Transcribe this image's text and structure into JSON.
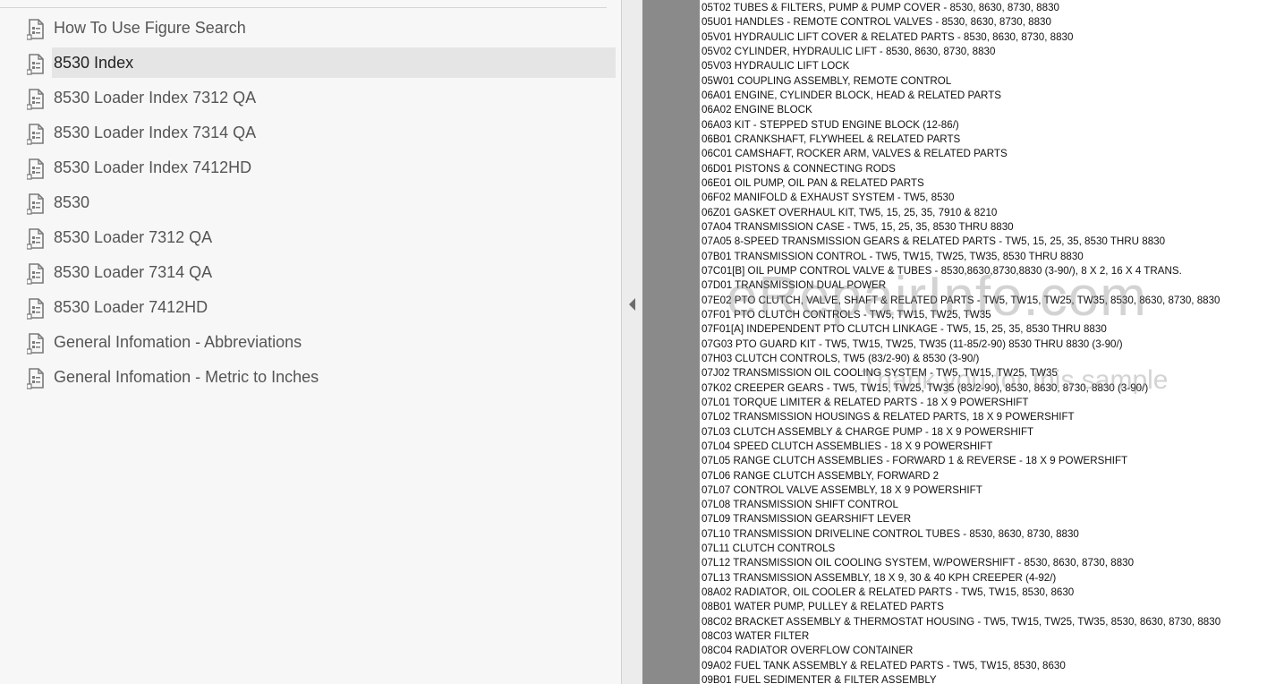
{
  "bookmarks": [
    {
      "label": "How To Use Figure Search",
      "selected": false
    },
    {
      "label": "8530 Index",
      "selected": true
    },
    {
      "label": "8530 Loader Index 7312 QA",
      "selected": false
    },
    {
      "label": "8530 Loader Index 7314 QA",
      "selected": false
    },
    {
      "label": "8530 Loader Index 7412HD",
      "selected": false
    },
    {
      "label": "8530",
      "selected": false
    },
    {
      "label": "8530 Loader 7312 QA",
      "selected": false
    },
    {
      "label": "8530 Loader 7314 QA",
      "selected": false
    },
    {
      "label": "8530 Loader 7412HD",
      "selected": false
    },
    {
      "label": "General Infomation - Abbreviations",
      "selected": false
    },
    {
      "label": "General Infomation - Metric to Inches",
      "selected": false
    }
  ],
  "icons": {
    "bookmark": "page-bookmark-icon",
    "collapse": "chevron-left-icon"
  },
  "watermark": {
    "main": "eRepairInfo.com",
    "sub": "Thank you for this sample"
  },
  "index_lines": [
    "05T02 TUBES & FILTERS, PUMP & PUMP COVER - 8530, 8630, 8730, 8830",
    "05U01 HANDLES - REMOTE CONTROL VALVES - 8530, 8630, 8730, 8830",
    "05V01 HYDRAULIC LIFT COVER & RELATED PARTS - 8530, 8630, 8730, 8830",
    "05V02 CYLINDER, HYDRAULIC LIFT - 8530, 8630, 8730, 8830",
    "05V03 HYDRAULIC LIFT LOCK",
    "05W01 COUPLING ASSEMBLY, REMOTE CONTROL",
    "06A01 ENGINE, CYLINDER BLOCK, HEAD & RELATED PARTS",
    "06A02 ENGINE BLOCK",
    "06A03 KIT - STEPPED STUD ENGINE BLOCK (12-86/)",
    "06B01 CRANKSHAFT, FLYWHEEL & RELATED PARTS",
    "06C01 CAMSHAFT, ROCKER ARM, VALVES & RELATED PARTS",
    "06D01 PISTONS & CONNECTING RODS",
    "06E01 OIL PUMP, OIL PAN & RELATED PARTS",
    "06F02 MANIFOLD & EXHAUST SYSTEM - TW5, 8530",
    "06Z01 GASKET OVERHAUL KIT, TW5, 15, 25, 35, 7910 & 8210",
    "07A04 TRANSMISSION CASE - TW5, 15, 25, 35, 8530 THRU 8830",
    "07A05 8-SPEED TRANSMISSION GEARS & RELATED PARTS - TW5, 15, 25, 35, 8530 THRU 8830",
    "07B01 TRANSMISSION CONTROL - TW5, TW15, TW25, TW35, 8530 THRU 8830",
    "07C01[B] OIL PUMP CONTROL VALVE & TUBES - 8530,8630,8730,8830 (3-90/), 8 X 2, 16 X 4 TRANS.",
    "07D01 TRANSMISSION DUAL POWER",
    "07E02 PTO CLUTCH, VALVE, SHAFT & RELATED PARTS - TW5, TW15, TW25, TW35, 8530, 8630, 8730, 8830",
    "07F01 PTO CLUTCH CONTROLS - TW5, TW15, TW25, TW35",
    "07F01[A] INDEPENDENT PTO CLUTCH LINKAGE - TW5, 15, 25, 35, 8530 THRU 8830",
    "07G03 PTO GUARD KIT - TW5, TW15, TW25, TW35 (11-85/2-90) 8530 THRU 8830 (3-90/)",
    "07H03 CLUTCH CONTROLS, TW5 (83/2-90) & 8530 (3-90/)",
    "07J02 TRANSMISSION OIL COOLING SYSTEM - TW5, TW15, TW25, TW35",
    "07K02 CREEPER GEARS - TW5, TW15, TW25, TW35 (83/2-90), 8530, 8630, 8730, 8830 (3-90/)",
    "07L01 TORQUE LIMITER & RELATED PARTS - 18 X 9 POWERSHIFT",
    "07L02 TRANSMISSION HOUSINGS & RELATED PARTS, 18 X 9 POWERSHIFT",
    "07L03 CLUTCH ASSEMBLY & CHARGE PUMP - 18 X 9 POWERSHIFT",
    "07L04 SPEED CLUTCH ASSEMBLIES - 18 X 9 POWERSHIFT",
    "07L05 RANGE CLUTCH ASSEMBLIES - FORWARD 1 & REVERSE - 18 X 9 POWERSHIFT",
    "07L06 RANGE CLUTCH ASSEMBLY, FORWARD 2",
    "07L07 CONTROL VALVE ASSEMBLY, 18 X 9 POWERSHIFT",
    "07L08 TRANSMISSION SHIFT CONTROL",
    "07L09 TRANSMISSION GEARSHIFT LEVER",
    "07L10 TRANSMISSION DRIVELINE CONTROL TUBES - 8530, 8630, 8730, 8830",
    "07L11 CLUTCH CONTROLS",
    "07L12 TRANSMISSION OIL COOLING SYSTEM, W/POWERSHIFT - 8530, 8630, 8730, 8830",
    "07L13 TRANSMISSION ASSEMBLY, 18 X 9, 30 & 40 KPH CREEPER (4-92/)",
    "08A02 RADIATOR, OIL COOLER & RELATED PARTS - TW5, TW15, 8530, 8630",
    "08B01 WATER PUMP, PULLEY & RELATED PARTS",
    "08C02 BRACKET ASSEMBLY & THERMOSTAT HOUSING - TW5, TW15, TW25, TW35, 8530, 8630, 8730, 8830",
    "08C03 WATER FILTER",
    "08C04 RADIATOR OVERFLOW CONTAINER",
    "09A02 FUEL TANK ASSEMBLY & RELATED PARTS - TW5, TW15, 8530, 8630",
    "09B01 FUEL SEDIMENTER & FILTER ASSEMBLY"
  ]
}
